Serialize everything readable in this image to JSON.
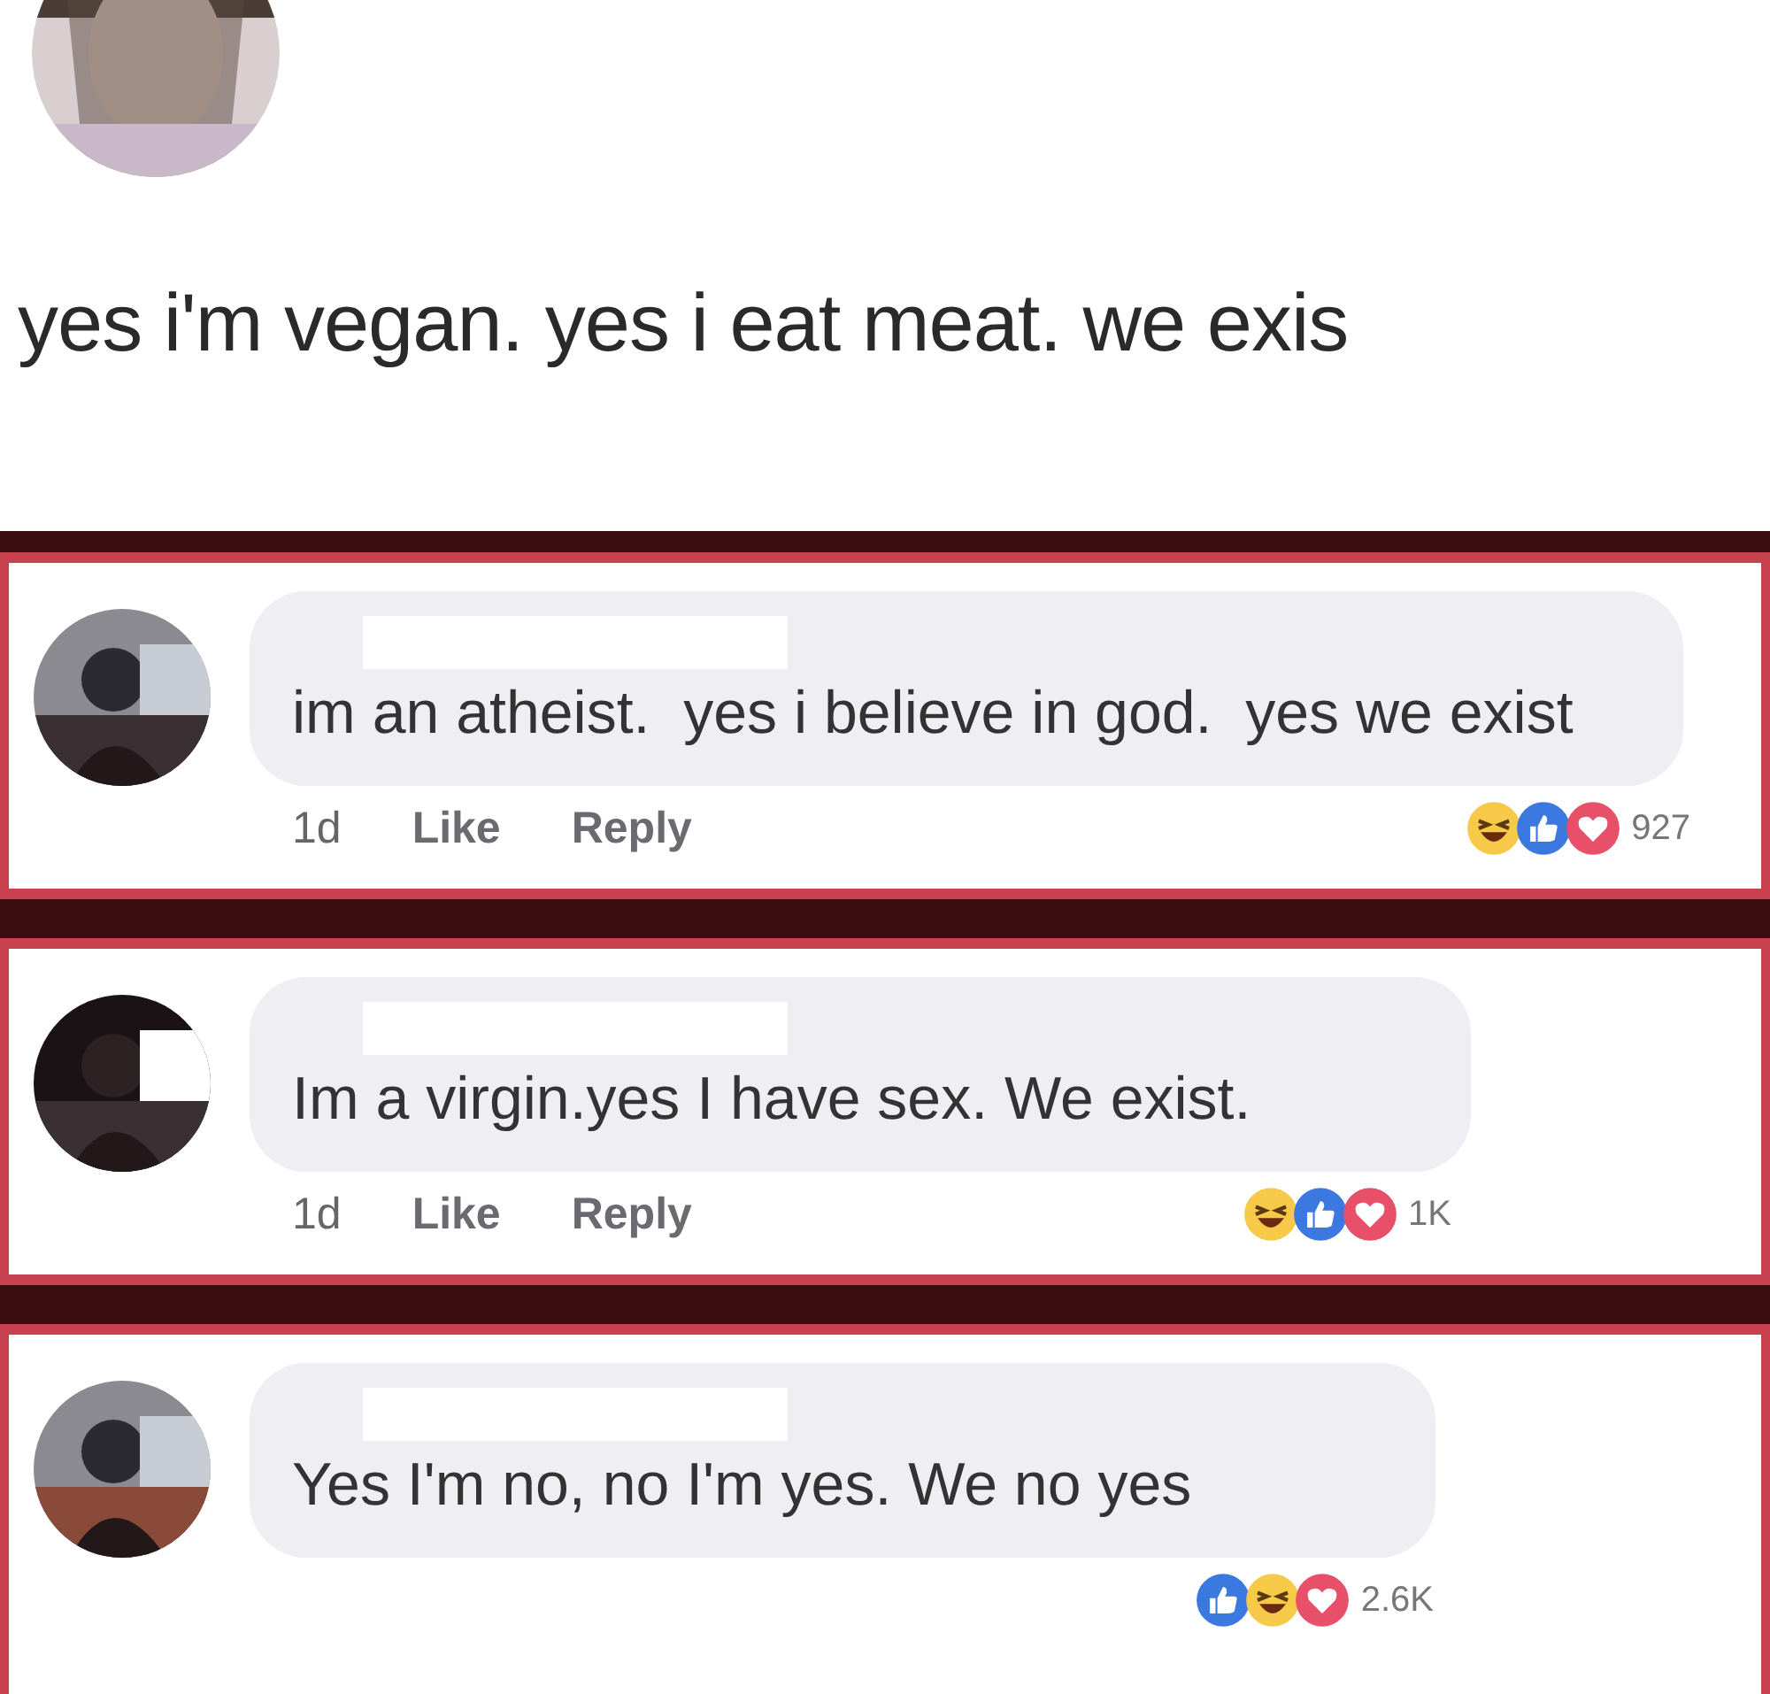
{
  "post": {
    "text": "yes i'm vegan. yes i eat meat. we exis"
  },
  "comments": [
    {
      "text": "im an atheist.  yes i believe in god.  yes we exist",
      "time": "1d",
      "like": "Like",
      "reply": "Reply",
      "reactions": [
        {
          "kind": "haha"
        },
        {
          "kind": "like"
        },
        {
          "kind": "love"
        }
      ],
      "count": "927"
    },
    {
      "text": "Im a virgin.yes I have sex. We exist.",
      "time": "1d",
      "like": "Like",
      "reply": "Reply",
      "reactions": [
        {
          "kind": "haha"
        },
        {
          "kind": "like"
        },
        {
          "kind": "love"
        }
      ],
      "count": "1K"
    },
    {
      "text": "Yes I'm no, no I'm yes. We no yes",
      "reactions": [
        {
          "kind": "like"
        },
        {
          "kind": "haha"
        },
        {
          "kind": "love"
        }
      ],
      "count": "2.6K"
    }
  ]
}
